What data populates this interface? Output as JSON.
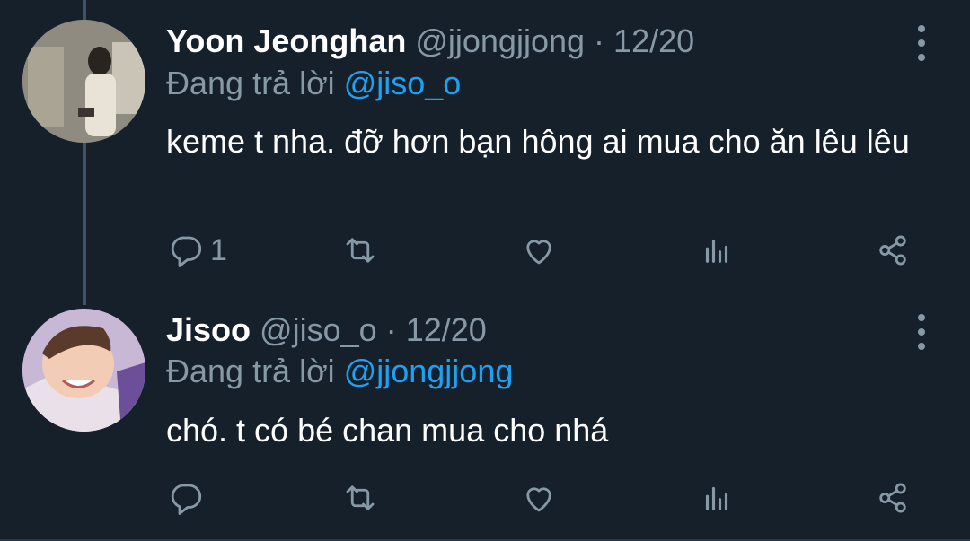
{
  "tweets": [
    {
      "name": "Yoon Jeonghan",
      "handle": "@jjongjjong",
      "separator": "·",
      "date": "12/20",
      "reply_prefix": "Đang trả lời",
      "reply_to": "@jiso_o",
      "text": "keme t nha. đỡ hơn bạn hông ai mua cho ăn lêu lêu",
      "reply_count": "1"
    },
    {
      "name": "Jisoo",
      "handle": "@jiso_o",
      "separator": "·",
      "date": "12/20",
      "reply_prefix": "Đang trả lời",
      "reply_to": "@jjongjjong",
      "text": "chó. t có bé chan mua cho nhá",
      "reply_count": ""
    }
  ],
  "icons": [
    "reply-icon",
    "retweet-icon",
    "like-icon",
    "stats-icon",
    "share-icon",
    "more-icon"
  ],
  "colors": {
    "background": "#15202b",
    "muted": "#8899a6",
    "link": "#1da1f2",
    "thread_line": "#3d5466"
  }
}
